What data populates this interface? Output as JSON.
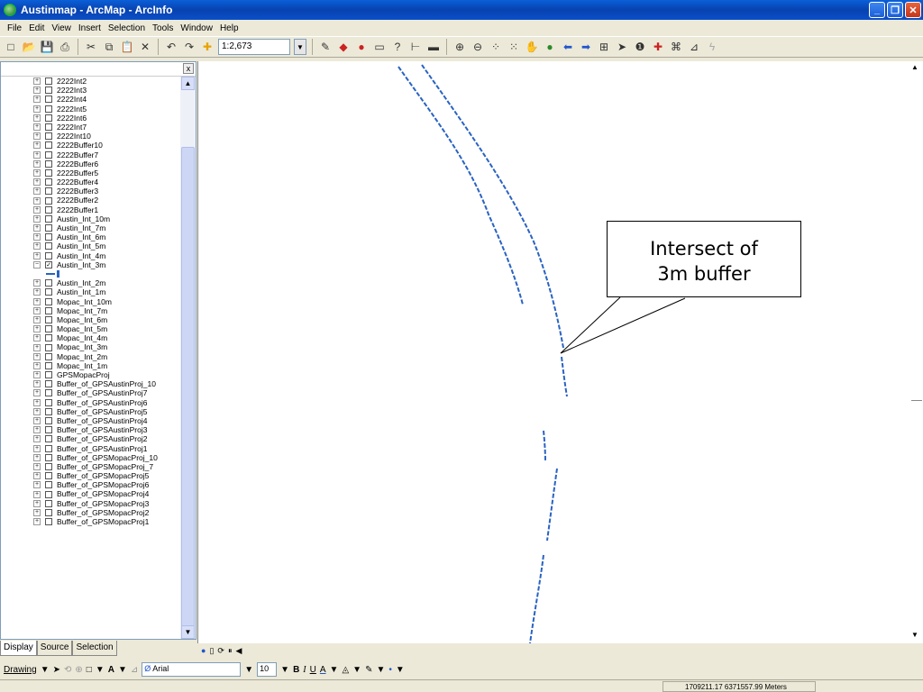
{
  "window": {
    "title": "Austinmap - ArcMap - ArcInfo"
  },
  "menu": [
    "File",
    "Edit",
    "View",
    "Insert",
    "Selection",
    "Tools",
    "Window",
    "Help"
  ],
  "toolbar": {
    "scale": "1:2,673"
  },
  "toc": {
    "layers_before": [
      "2222Int2",
      "2222Int3",
      "2222Int4",
      "2222Int5",
      "2222Int6",
      "2222Int7",
      "2222Int10",
      "2222Buffer10",
      "2222Buffer7",
      "2222Buffer6",
      "2222Buffer5",
      "2222Buffer4",
      "2222Buffer3",
      "2222Buffer2",
      "2222Buffer1",
      "Austin_Int_10m",
      "Austin_Int_7m",
      "Austin_Int_6m",
      "Austin_Int_5m",
      "Austin_Int_4m"
    ],
    "checked_layer": "Austin_Int_3m",
    "layers_after": [
      "Austin_Int_2m",
      "Austin_Int_1m",
      "Mopac_Int_10m",
      "Mopac_Int_7m",
      "Mopac_Int_6m",
      "Mopac_Int_5m",
      "Mopac_Int_4m",
      "Mopac_Int_3m",
      "Mopac_Int_2m",
      "Mopac_Int_1m",
      "GPSMopacProj",
      "Buffer_of_GPSAustinProj_10",
      "Buffer_of_GPSAustinProj7",
      "Buffer_of_GPSAustinProj6",
      "Buffer_of_GPSAustinProj5",
      "Buffer_of_GPSAustinProj4",
      "Buffer_of_GPSAustinProj3",
      "Buffer_of_GPSAustinProj2",
      "Buffer_of_GPSAustinProj1",
      "Buffer_of_GPSMopacProj_10",
      "Buffer_of_GPSMopacProj_7",
      "Buffer_of_GPSMopacProj5",
      "Buffer_of_GPSMopacProj6",
      "Buffer_of_GPSMopacProj4",
      "Buffer_of_GPSMopacProj3",
      "Buffer_of_GPSMopacProj2",
      "Buffer_of_GPSMopacProj1"
    ],
    "tabs": [
      "Display",
      "Source",
      "Selection"
    ]
  },
  "map": {
    "annotation_line1": "Intersect of",
    "annotation_line2": "3m buffer",
    "line_color": "#2a63c2"
  },
  "drawing": {
    "label": "Drawing",
    "font": "Arial",
    "size": "10",
    "bold": "B",
    "italic": "I",
    "underline": "U"
  },
  "status": {
    "coords": "1709211.17  6371557.99 Meters"
  }
}
